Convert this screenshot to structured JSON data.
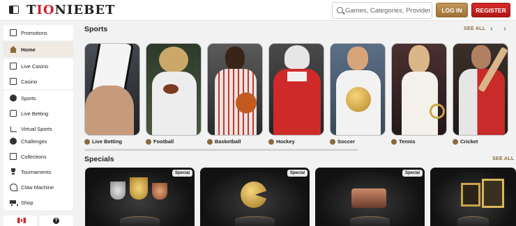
{
  "header": {
    "logo_text_prefix": "T",
    "logo_text_io": "IO",
    "logo_text_suffix": "NIEBET",
    "search_placeholder": "Games, Categories, Providers",
    "login_label": "LOG IN",
    "register_label": "REGISTER"
  },
  "sidebar": {
    "groups": [
      [
        {
          "label": "Promotions",
          "icon": "gift-icon"
        }
      ],
      [
        {
          "label": "Home",
          "icon": "home-icon",
          "active": true
        }
      ],
      [
        {
          "label": "Live Casino",
          "icon": "casino-icon"
        },
        {
          "label": "Casino",
          "icon": "cards-icon"
        }
      ],
      [
        {
          "label": "Sports",
          "icon": "ball-icon"
        },
        {
          "label": "Live Betting",
          "icon": "live-icon"
        },
        {
          "label": "Virtual Sports",
          "icon": "monitor-icon"
        }
      ],
      [
        {
          "label": "Challenges",
          "icon": "target-icon"
        },
        {
          "label": "Collections",
          "icon": "collection-icon"
        },
        {
          "label": "Tournaments",
          "icon": "trophy-icon"
        },
        {
          "label": "Claw Machine",
          "icon": "claw-icon"
        },
        {
          "label": "Shop",
          "icon": "cart-icon"
        }
      ]
    ],
    "help_symbol": "?"
  },
  "sports": {
    "title": "Sports",
    "see_all": "SEE ALL",
    "prev_arrow": "‹",
    "next_arrow": "›",
    "cards": [
      {
        "label": "Live Betting",
        "icon": "live-betting-icon"
      },
      {
        "label": "Football",
        "icon": "football-icon"
      },
      {
        "label": "Basketball",
        "icon": "basketball-icon"
      },
      {
        "label": "Hockey",
        "icon": "hockey-icon"
      },
      {
        "label": "Soccer",
        "icon": "soccer-icon"
      },
      {
        "label": "Tennis",
        "icon": "tennis-icon"
      },
      {
        "label": "Cricket",
        "icon": "cricket-icon"
      }
    ]
  },
  "specials": {
    "title": "Specials",
    "see_all": "SEE ALL",
    "badge": "Special",
    "cards": [
      {
        "badge": "Special"
      },
      {
        "badge": "Special"
      },
      {
        "badge": "Special"
      },
      {
        "badge": ""
      }
    ]
  },
  "colors": {
    "accent_gold": "#8a6a3a",
    "register_red": "#cf1f2f",
    "login_gold": "#b58447"
  }
}
